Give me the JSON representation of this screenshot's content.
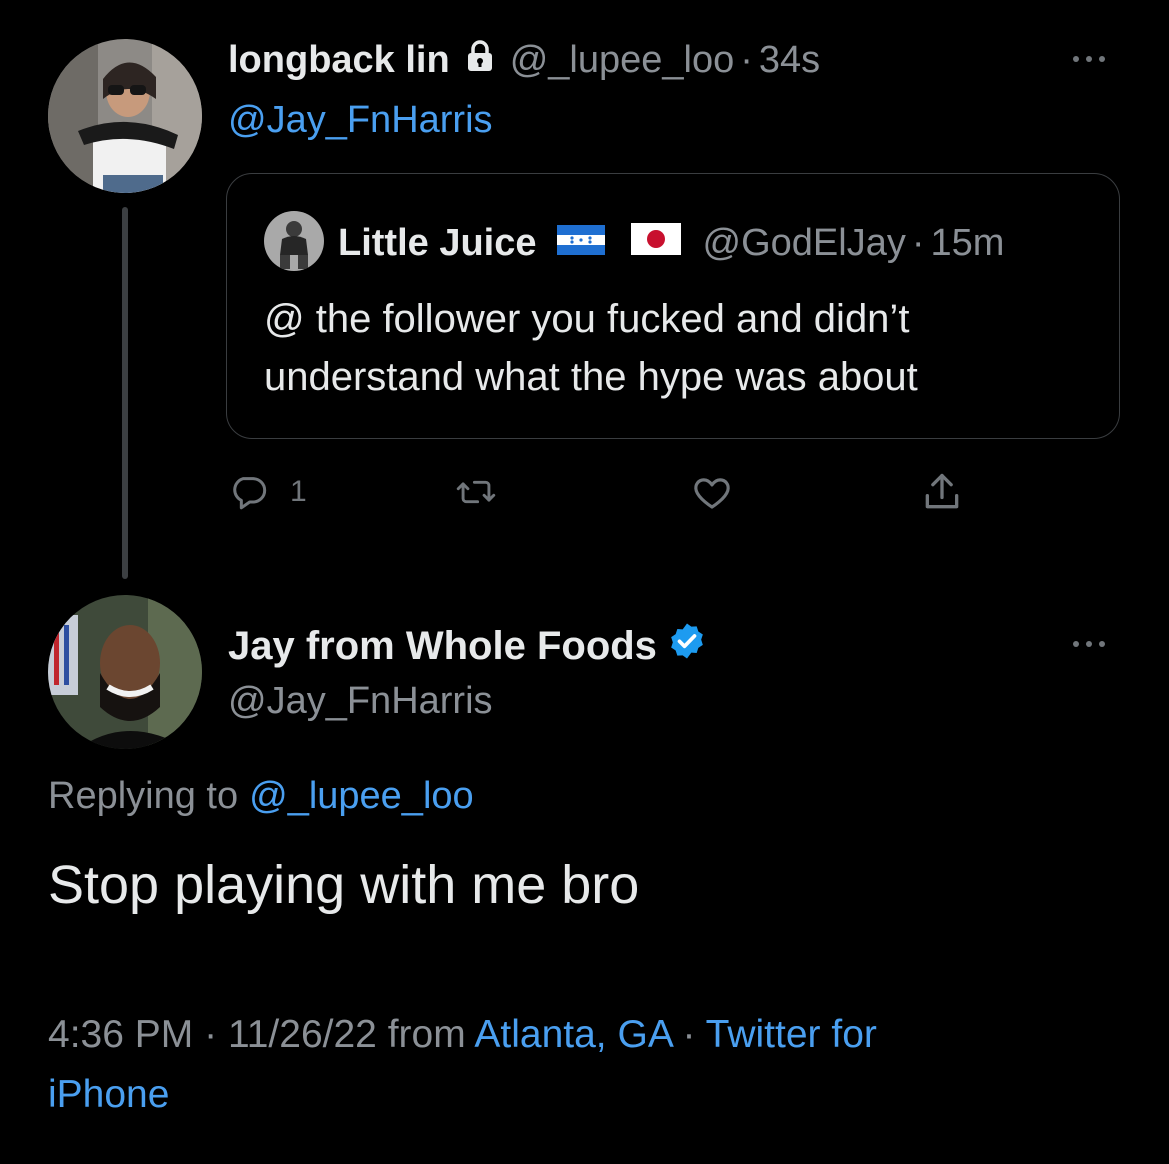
{
  "tweet1": {
    "display_name": "longback lin",
    "handle": "@_lupee_loo",
    "separator": "·",
    "time": "34s",
    "mention": "@Jay_FnHarris",
    "quoted": {
      "display_name": "Little Juice",
      "handle": "@GodElJay",
      "separator": "·",
      "time": "15m",
      "text": "@ the follower you fucked and didn’t understand what the hype was about"
    },
    "reply_count": "1"
  },
  "tweet2": {
    "display_name": "Jay from Whole Foods",
    "handle": "@Jay_FnHarris",
    "replying_prefix": "Replying to",
    "replying_handle": "@_lupee_loo",
    "text": "Stop playing with me bro",
    "time": "4:36 PM",
    "sep1": "·",
    "date": "11/26/22",
    "from": "from",
    "location": "Atlanta, GA",
    "sep2": "·",
    "source_line1": "Twitter for",
    "source_line2": "iPhone"
  },
  "colors": {
    "background": "#000000",
    "text": "#e7e9ea",
    "muted": "#8b9096",
    "link": "#4a9ff0",
    "verified": "#1d9bf0"
  },
  "icons": [
    "lock-icon",
    "honduras-flag-icon",
    "japan-flag-icon",
    "reply-icon",
    "retweet-icon",
    "like-icon",
    "share-icon",
    "verified-badge-icon",
    "more-icon"
  ]
}
